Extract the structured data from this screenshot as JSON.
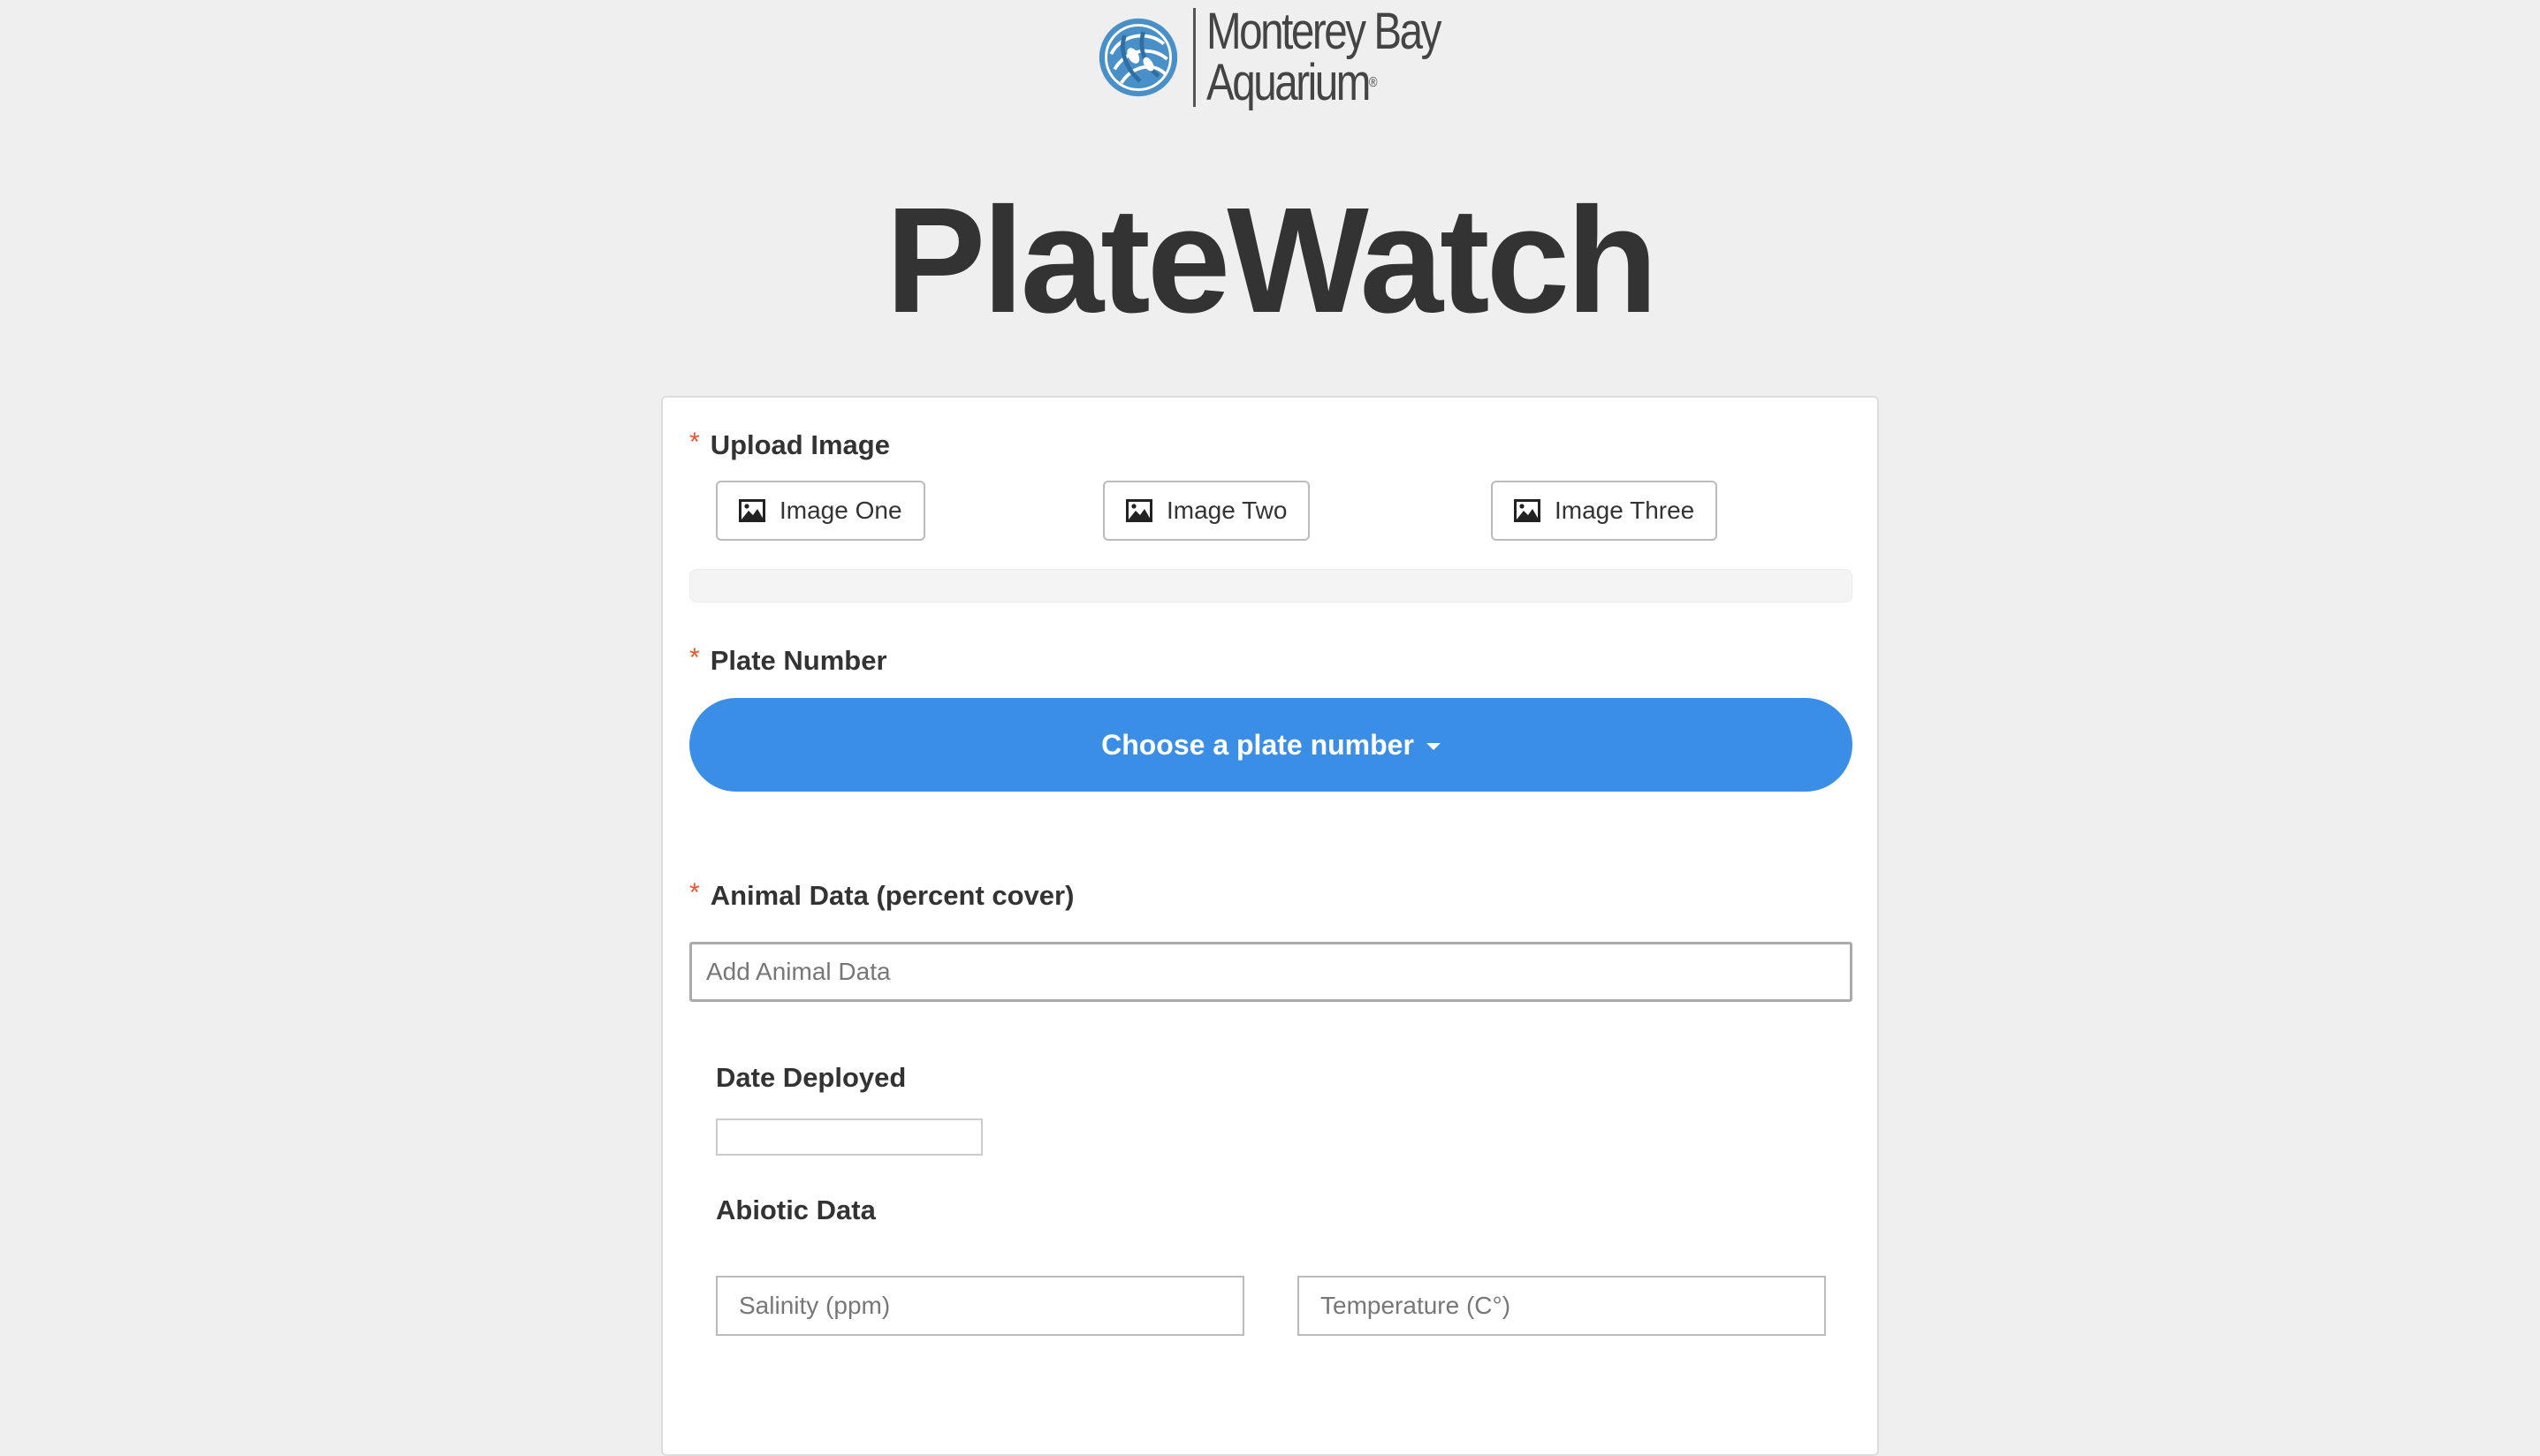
{
  "header": {
    "logo_line1": "Monterey Bay",
    "logo_line2": "Aquarium",
    "logo_mark": "®",
    "logo_icon": "aquarium-swirl-icon",
    "app_title": "PlateWatch"
  },
  "form": {
    "required_marker": "*",
    "upload": {
      "label": "Upload Image",
      "buttons": [
        {
          "label": "Image One",
          "icon": "image-icon"
        },
        {
          "label": "Image Two",
          "icon": "image-icon"
        },
        {
          "label": "Image Three",
          "icon": "image-icon"
        }
      ],
      "progress_fraction": 0
    },
    "plate_number": {
      "label": "Plate Number",
      "dropdown_label": "Choose a plate number",
      "icon": "caret-down-icon"
    },
    "animal_data": {
      "label": "Animal Data (percent cover)",
      "placeholder": "Add Animal Data",
      "value": ""
    },
    "date_deployed": {
      "label": "Date Deployed",
      "value": ""
    },
    "abiotic_data": {
      "label": "Abiotic Data",
      "salinity_placeholder": "Salinity (ppm)",
      "temperature_placeholder": "Temperature (C°)"
    }
  },
  "colors": {
    "background": "#efefef",
    "primary_button": "#3a8ee6",
    "required_asterisk": "#e8552f",
    "title_text": "#333333",
    "logo_blue": "#4a90c8"
  }
}
